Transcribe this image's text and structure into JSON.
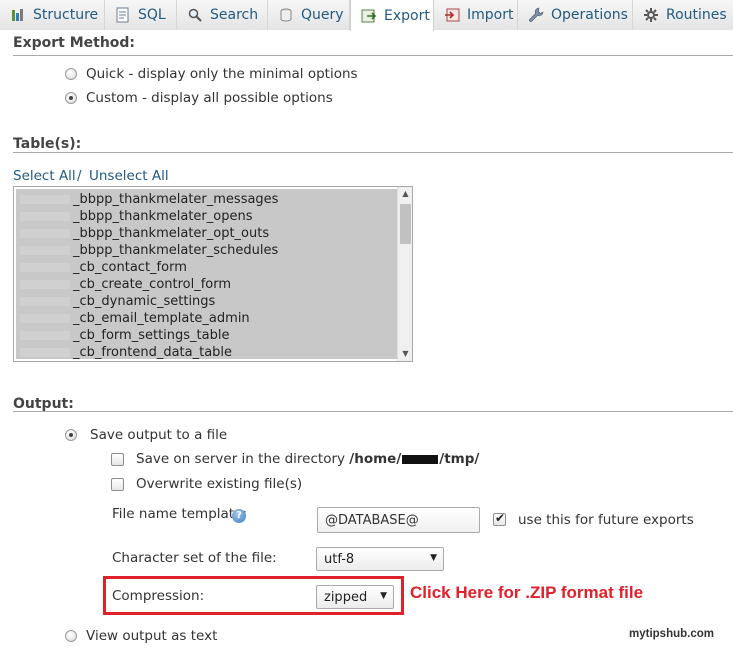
{
  "tabs": [
    {
      "label": "Structure",
      "icon": "structure-icon",
      "active": false
    },
    {
      "label": "SQL",
      "icon": "sql-icon",
      "active": false
    },
    {
      "label": "Search",
      "icon": "search-icon",
      "active": false
    },
    {
      "label": "Query",
      "icon": "query-icon",
      "active": false
    },
    {
      "label": "Export",
      "icon": "export-icon",
      "active": true
    },
    {
      "label": "Import",
      "icon": "import-icon",
      "active": false
    },
    {
      "label": "Operations",
      "icon": "wrench-icon",
      "active": false
    },
    {
      "label": "Routines",
      "icon": "routines-icon",
      "active": false
    }
  ],
  "export_method": {
    "title": "Export Method:",
    "options": [
      {
        "label": "Quick - display only the minimal options",
        "selected": false
      },
      {
        "label": "Custom - display all possible options",
        "selected": true
      }
    ]
  },
  "tables": {
    "title": "Table(s):",
    "select_all": "Select All",
    "separator": " / ",
    "unselect_all": "Unselect All",
    "items": [
      "_bbpp_thankmelater_messages",
      "_bbpp_thankmelater_opens",
      "_bbpp_thankmelater_opt_outs",
      "_bbpp_thankmelater_schedules",
      "_cb_contact_form",
      "_cb_create_control_form",
      "_cb_dynamic_settings",
      "_cb_email_template_admin",
      "_cb_form_settings_table",
      "_cb_frontend_data_table"
    ]
  },
  "output": {
    "title": "Output:",
    "save_to_file": {
      "label": "Save output to a file",
      "selected": true
    },
    "save_on_server": {
      "label": "Save on server in the directory ",
      "path_start": "/home/",
      "path_end": "/tmp/",
      "checked": false
    },
    "overwrite": {
      "label": "Overwrite existing file(s)",
      "checked": false
    },
    "file_name_template": {
      "label": "File name template:",
      "value": "@DATABASE@"
    },
    "future_exports": {
      "label": "use this for future exports",
      "checked": true
    },
    "charset": {
      "label": "Character set of the file:",
      "value": "utf-8"
    },
    "compression": {
      "label": "Compression:",
      "value": "zipped"
    },
    "view_as_text": {
      "label": "View output as text",
      "selected": false
    }
  },
  "annotation": {
    "text": "Click Here for .ZIP format file",
    "color": "#e0202a"
  },
  "watermark": "mytipshub.com"
}
